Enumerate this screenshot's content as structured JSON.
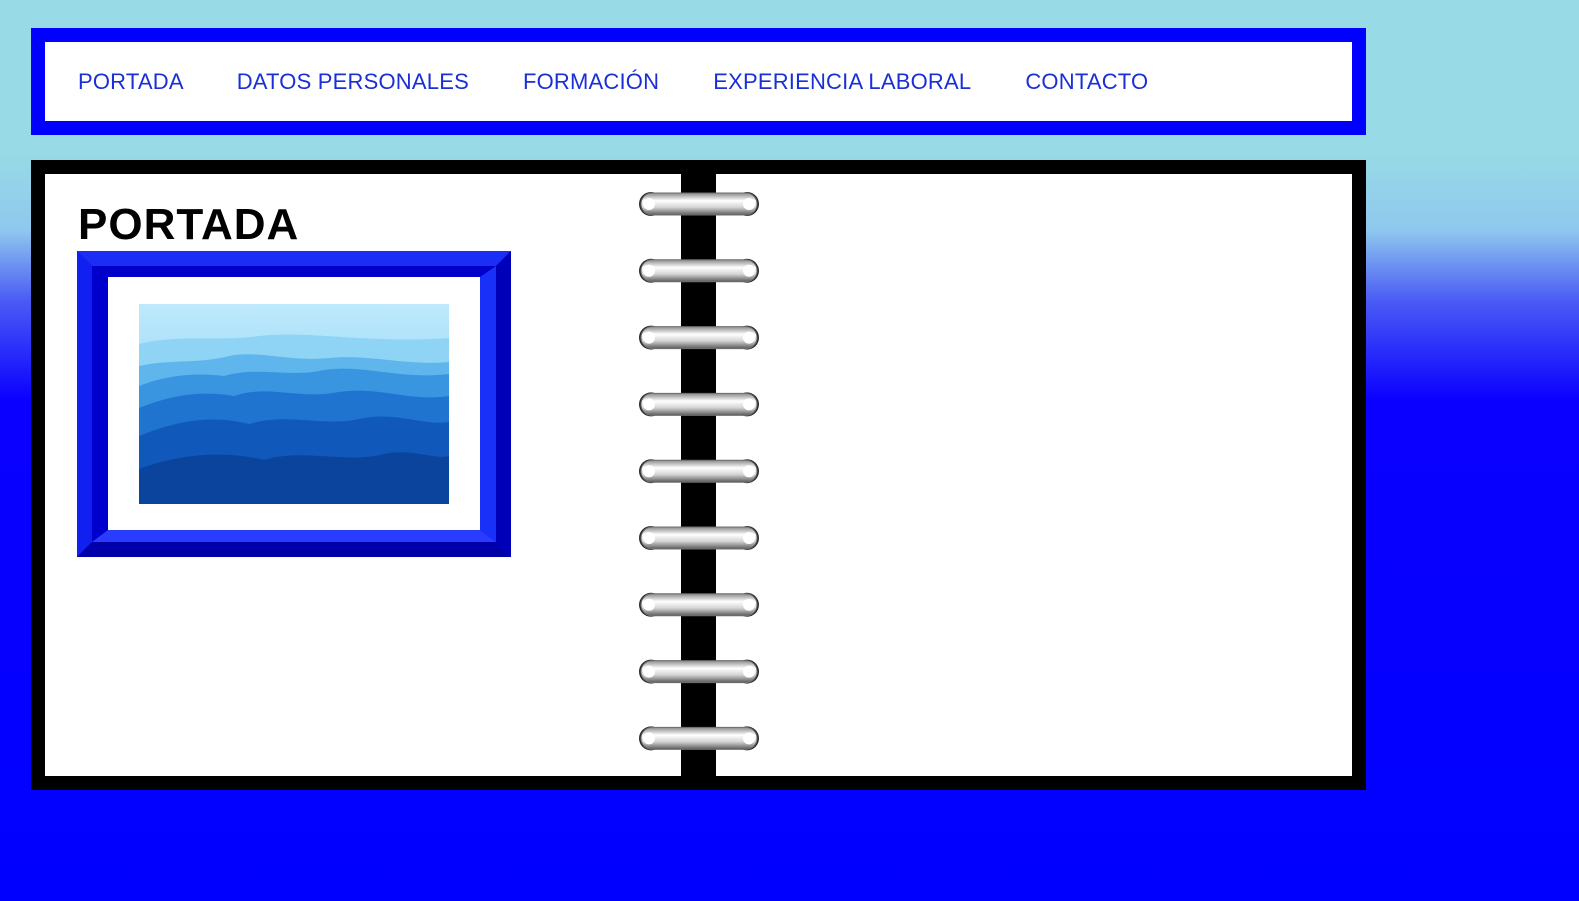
{
  "nav": {
    "items": [
      {
        "label": "PORTADA"
      },
      {
        "label": "DATOS PERSONALES"
      },
      {
        "label": "FORMACIÓN"
      },
      {
        "label": "EXPERIENCIA LABORAL"
      },
      {
        "label": "CONTACTO"
      }
    ]
  },
  "page": {
    "title": "PORTADA"
  },
  "colors": {
    "nav_border": "#0000ff",
    "nav_text": "#1a2fd6",
    "book_border": "#000000",
    "frame": "#0000ee",
    "background_top": "#98dbe6",
    "background_bottom": "#0000ff"
  },
  "icons": {
    "spiral": "spiral-binding-icon",
    "photo": "mountain-landscape-image"
  }
}
